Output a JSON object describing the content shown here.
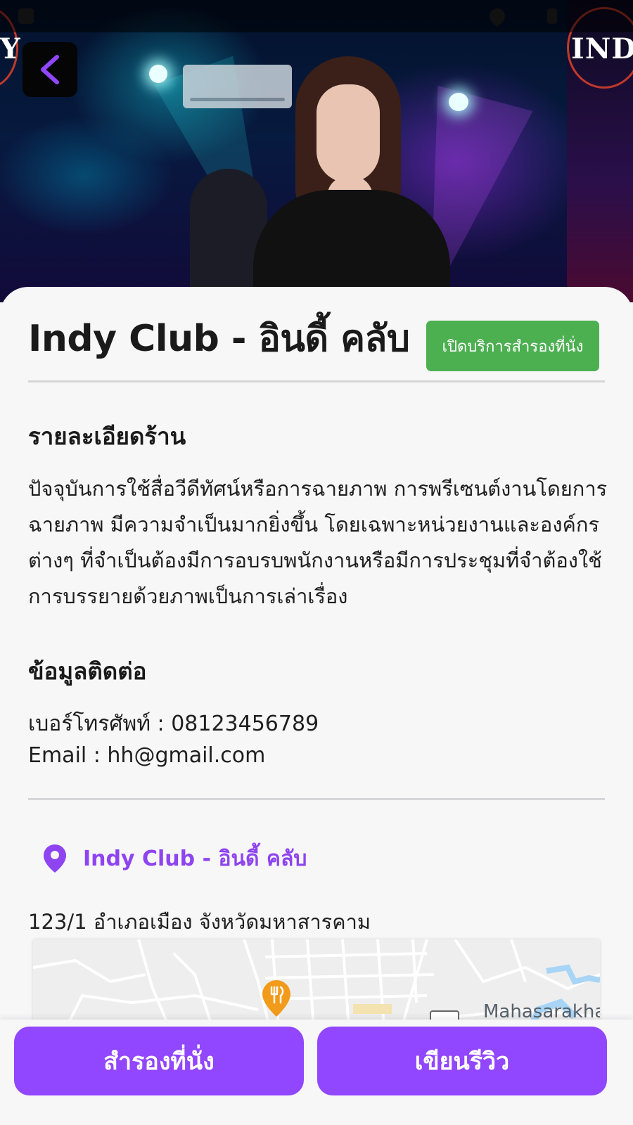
{
  "place": {
    "title": "Indy Club - อินดี้ คลับ",
    "status_badge": "เปิดบริการสำรองที่นั่ง"
  },
  "details": {
    "heading": "รายละเอียดร้าน",
    "description": "ปัจจุบันการใช้สื่อวีดีทัศน์หรือการฉายภาพ การพรีเซนต์งานโดยการฉายภาพ มีความจำเป็นมากยิ่งขึ้น โดยเฉพาะหน่วยงานและองค์กรต่างๆ ที่จำเป็นต้องมีการอบรบพนักงานหรือมีการประชุมที่จำต้องใช้การบรรยายด้วยภาพเป็นการเล่าเรื่อง"
  },
  "contact": {
    "heading": "ข้อมูลติดต่อ",
    "phone_line": "เบอร์โทรศัพท์  : 08123456789",
    "email_line": "Email  : hh@gmail.com"
  },
  "location": {
    "name": "Indy Club - อินดี้ คลับ",
    "address": "123/1 อำเภอเมือง จังหวัดมหาสารคาม",
    "map_label": "Mahasarakha"
  },
  "hero": {
    "logo_text": "INDY",
    "logo_text_left": "Y"
  },
  "actions": {
    "reserve_label": "สำรองที่นั่ง",
    "review_label": "เขียนรีวิว"
  },
  "colors": {
    "accent": "#9146ff",
    "status_green": "#4caf50",
    "location_text": "#8e44f0"
  }
}
